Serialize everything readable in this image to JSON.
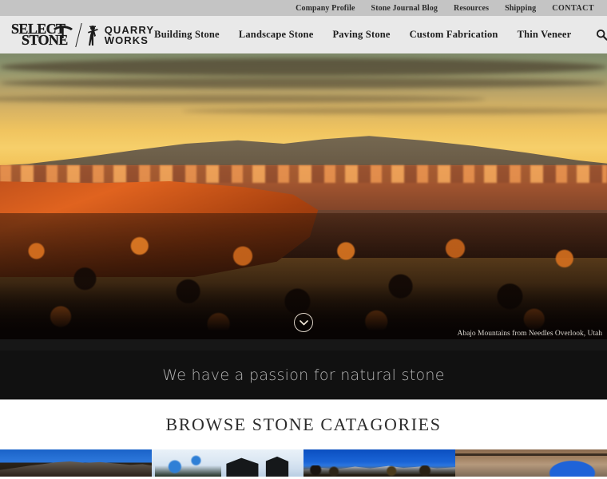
{
  "topbar": {
    "links": [
      {
        "label": "Company Profile",
        "name": "topbar-link-company-profile"
      },
      {
        "label": "Stone Journal Blog",
        "name": "topbar-link-stone-journal-blog"
      },
      {
        "label": "Resources",
        "name": "topbar-link-resources"
      },
      {
        "label": "Shipping",
        "name": "topbar-link-shipping"
      },
      {
        "label": "CONTACT",
        "name": "topbar-link-contact"
      }
    ]
  },
  "logo": {
    "word_1": "SELECT",
    "word_2": "STONE",
    "right_line_1": "QUARRY",
    "right_line_2": "WORKS",
    "pickaxe_icon": "pickaxe-icon",
    "miner_icon": "miner-icon"
  },
  "mainnav": {
    "items": [
      {
        "label": "Building Stone",
        "name": "nav-item-building-stone"
      },
      {
        "label": "Landscape Stone",
        "name": "nav-item-landscape-stone"
      },
      {
        "label": "Paving Stone",
        "name": "nav-item-paving-stone"
      },
      {
        "label": "Custom Fabrication",
        "name": "nav-item-custom-fabrication"
      },
      {
        "label": "Thin Veneer",
        "name": "nav-item-thin-veneer"
      }
    ],
    "search_icon": "search-icon"
  },
  "hero": {
    "caption": "Abajo Mountains from Needles Overlook, Utah",
    "scroll_icon": "chevron-down-icon",
    "alt": "Sunset over red rock mesas and juniper forest"
  },
  "tagline": {
    "text": "We have a passion for natural stone"
  },
  "browse": {
    "title": "BROWSE STONE CATAGORIES",
    "tiles": [
      {
        "name": "category-tile-1",
        "alt": "Mountain ridge under blue sky"
      },
      {
        "name": "category-tile-2",
        "alt": "Snowy house with stone chimney"
      },
      {
        "name": "category-tile-3",
        "alt": "Snow capped mountains with autumn trees"
      },
      {
        "name": "category-tile-4",
        "alt": "Stone fabrication workshop interior"
      }
    ]
  },
  "colors": {
    "topbar_bg": "#c4c4c4",
    "header_bg": "#e9e9e9",
    "dark_band": "#111111",
    "caption_band": "#171717",
    "text_dark": "#1d1d1d",
    "tagline_text": "#b3b3b3"
  }
}
